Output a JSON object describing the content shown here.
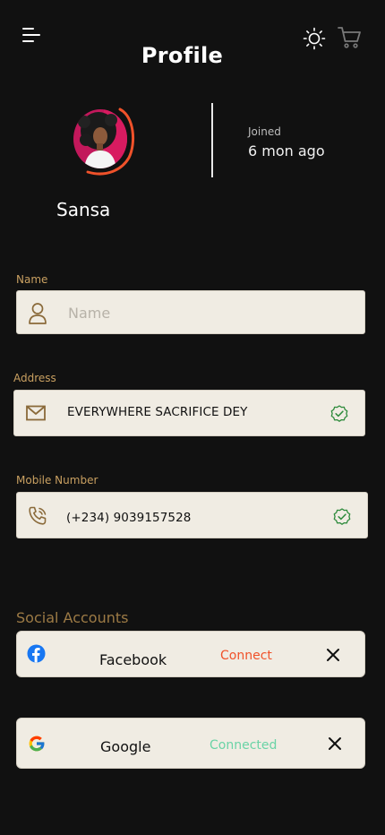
{
  "header": {
    "title": "Profile",
    "menu_icon": "menu-icon",
    "theme_icon": "sun-icon",
    "cart_icon": "cart-icon"
  },
  "profile": {
    "name": "Sansa",
    "joined_label": "Joined",
    "joined_value": "6 mon ago",
    "ring_color": "#f0522a"
  },
  "form": {
    "name": {
      "label": "Name",
      "placeholder": "Name",
      "value": "",
      "icon": "user-icon"
    },
    "address": {
      "label": "Address",
      "value": "EVERYWHERE SACRIFICE  DEY",
      "icon": "mail-icon",
      "verified_icon": "verified-check-icon"
    },
    "mobile": {
      "label": "Mobile Number",
      "value": "(+234) 9039157528",
      "icon": "phone-icon",
      "verified_icon": "verified-check-icon"
    }
  },
  "social": {
    "title": "Social Accounts",
    "accounts": [
      {
        "name": "Facebook",
        "status": "Connect",
        "status_color": "#f0522a",
        "icon": "facebook-icon"
      },
      {
        "name": "Google",
        "status": "Connected",
        "status_color": "#6ad3a6",
        "icon": "google-icon"
      }
    ]
  },
  "colors": {
    "background": "#111111",
    "label": "#c9a061",
    "field_bg": "#f0ece3",
    "icon_brown": "#8a6a3a",
    "verified_green": "#2e8b3c"
  }
}
